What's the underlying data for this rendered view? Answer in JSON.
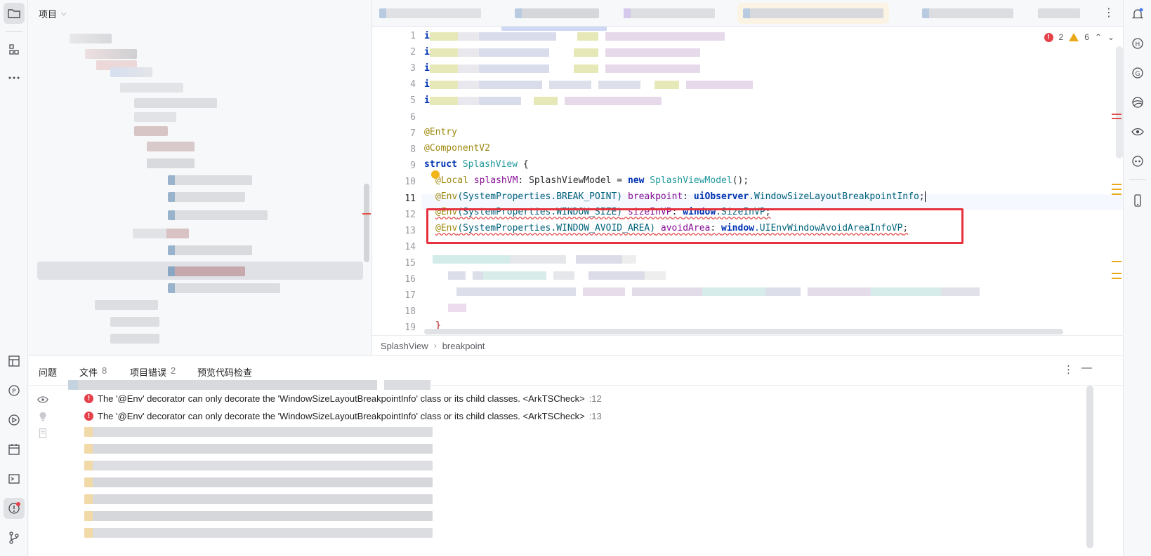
{
  "project": {
    "title": "项目",
    "selected_row_index": 9
  },
  "editor": {
    "line_numbers": [
      "1",
      "2",
      "3",
      "4",
      "5",
      "6",
      "7",
      "8",
      "9",
      "10",
      "11",
      "12",
      "13",
      "14",
      "15",
      "16",
      "17",
      "18",
      "19"
    ],
    "current_line": "11",
    "code": {
      "l1": "i",
      "l2": "i",
      "l3": "i",
      "l4": "i",
      "l5": "i",
      "l7": "@Entry",
      "l8": "@ComponentV2",
      "l9_kw": "struct",
      "l9_name": "SplashView",
      "l9_brace": " {",
      "l10_dec": "@Local",
      "l10_name": " splashVM",
      "l10_colon": ": ",
      "l10_type": "SplashViewModel",
      "l10_eq": " = ",
      "l10_new": "new",
      "l10_ctor": " SplashViewModel",
      "l10_end": "();",
      "l11_dec": "@Env",
      "l11_arg": "(SystemProperties.BREAK_POINT)",
      "l11_name": " breakpoint",
      "l11_colon": ": ",
      "l11_ns": "uiObserver",
      "l11_type": ".WindowSizeLayoutBreakpointInfo",
      "l11_end": ";",
      "l12_dec": "@Env",
      "l12_arg": "(SystemProperties.WINDOW_SIZE)",
      "l12_name": " sizeInVP",
      "l12_colon": ": ",
      "l12_ns": "window",
      "l12_type": ".SizeInVP",
      "l12_end": ";",
      "l13_dec": "@Env",
      "l13_arg": "(SystemProperties.WINDOW_AVOID_AREA)",
      "l13_name": " avoidArea",
      "l13_colon": ": ",
      "l13_ns": "window",
      "l13_type": ".UIEnvWindowAvoidAreaInfoVP",
      "l13_end": ";",
      "l19": "}"
    },
    "inspection": {
      "errors": "2",
      "warnings": "6",
      "error_icon": "!"
    },
    "breadcrumbs": [
      "SplashView",
      "breakpoint"
    ]
  },
  "problems": {
    "tabs": [
      {
        "label": "问题",
        "count": ""
      },
      {
        "label": "文件",
        "count": "8"
      },
      {
        "label": "项目错误",
        "count": "2"
      },
      {
        "label": "预览代码检查",
        "count": ""
      }
    ],
    "messages": [
      {
        "text": "The '@Env' decorator can only decorate the 'WindowSizeLayoutBreakpointInfo' class or its child classes. <ArkTSCheck>",
        "line": ":12"
      },
      {
        "text": "The '@Env' decorator can only decorate the 'WindowSizeLayoutBreakpointInfo' class or its child classes. <ArkTSCheck>",
        "line": ":13"
      }
    ],
    "error_icon": "!"
  },
  "icons": {
    "left": [
      "folder-icon",
      "structure-icon",
      "more-icon",
      "layout-icon",
      "plugin-icon",
      "run-icon",
      "todo-icon",
      "terminal-icon",
      "problems-icon",
      "git-icon"
    ],
    "right": [
      "notification-icon",
      "h-icon",
      "g-icon",
      "globe-icon",
      "eye-icon",
      "robot-icon",
      "device-icon"
    ]
  },
  "colors": {
    "error": "#e5404a",
    "warning": "#e8a817",
    "highlight_box": "#e5323e",
    "accent": "#4a7af0"
  }
}
